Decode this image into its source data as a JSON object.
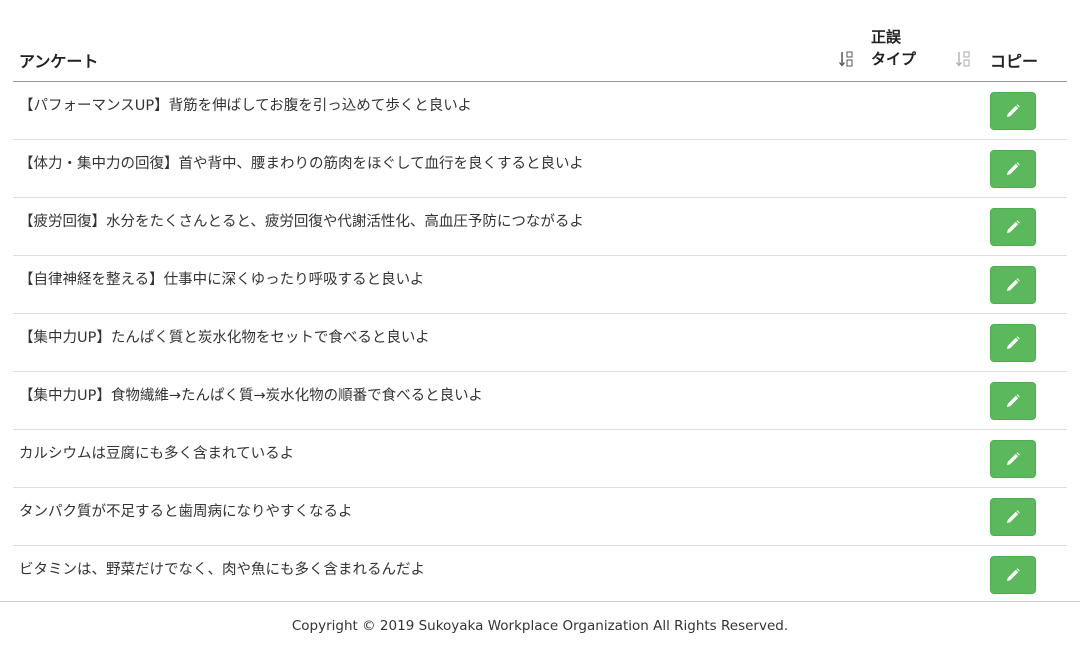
{
  "table": {
    "headers": {
      "survey": "アンケート",
      "type_line1": "正誤",
      "type_line2": "タイプ",
      "copy": "コピー"
    },
    "rows": [
      {
        "text": "【パフォーマンスUP】背筋を伸ばしてお腹を引っ込めて歩くと良いよ"
      },
      {
        "text": "【体力・集中力の回復】首や背中、腰まわりの筋肉をほぐして血行を良くすると良いよ"
      },
      {
        "text": "【疲労回復】水分をたくさんとると、疲労回復や代謝活性化、高血圧予防につながるよ"
      },
      {
        "text": "【自律神経を整える】仕事中に深くゆったり呼吸すると良いよ"
      },
      {
        "text": "【集中力UP】たんぱく質と炭水化物をセットで食べると良いよ"
      },
      {
        "text": "【集中力UP】食物繊維→たんぱく質→炭水化物の順番で食べると良いよ"
      },
      {
        "text": "カルシウムは豆腐にも多く含まれているよ"
      },
      {
        "text": "タンパク質が不足すると歯周病になりやすくなるよ"
      },
      {
        "text": "ビタミンは、野菜だけでなく、肉や魚にも多く含まれるんだよ"
      }
    ],
    "edit_icon": "pencil-icon",
    "sort_icon": "sort-numeric-icon",
    "button_color": "#5cb85c"
  },
  "footer": {
    "copyright": "Copyright © 2019 Sukoyaka Workplace Organization All Rights Reserved."
  }
}
